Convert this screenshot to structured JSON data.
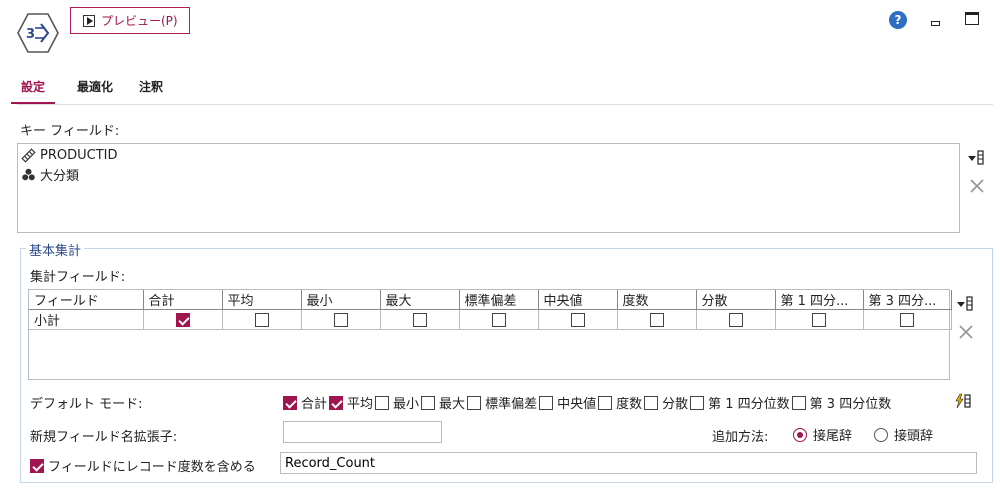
{
  "header": {
    "preview_label": "プレビュー(P)"
  },
  "tabs": [
    {
      "label": "設定",
      "active": true
    },
    {
      "label": "最適化",
      "active": false
    },
    {
      "label": "注釈",
      "active": false
    }
  ],
  "key_fields": {
    "label": "キー フィールド:",
    "items": [
      {
        "name": "PRODUCTID",
        "icon": "nominal-field-icon"
      },
      {
        "name": "大分類",
        "icon": "set-field-icon"
      }
    ]
  },
  "basic_agg": {
    "legend": "基本集計",
    "agg_fields_label": "集計フィールド:",
    "columns": [
      "フィールド",
      "合計",
      "平均",
      "最小",
      "最大",
      "標準偏差",
      "中央値",
      "度数",
      "分散",
      "第 1 四分...",
      "第 3 四分..."
    ],
    "rows": [
      {
        "field": "小計",
        "checks": [
          true,
          false,
          false,
          false,
          false,
          false,
          false,
          false,
          false,
          false
        ]
      }
    ],
    "default_mode_label": "デフォルト モード:",
    "default_modes": [
      {
        "label": "合計",
        "checked": true
      },
      {
        "label": "平均",
        "checked": true
      },
      {
        "label": "最小",
        "checked": false
      },
      {
        "label": "最大",
        "checked": false
      },
      {
        "label": "標準偏差",
        "checked": false
      },
      {
        "label": "中央値",
        "checked": false
      },
      {
        "label": "度数",
        "checked": false
      },
      {
        "label": "分散",
        "checked": false
      },
      {
        "label": "第 1 四分位数",
        "checked": false
      },
      {
        "label": "第 3 四分位数",
        "checked": false
      }
    ],
    "new_field_ext_label": "新規フィールド名拡張子:",
    "new_field_ext_value": "",
    "append_method_label": "追加方法:",
    "suffix_label": "接尾辞",
    "prefix_label": "接頭辞",
    "suffix_selected": true,
    "include_count_label": "フィールドにレコード度数を含める",
    "include_count_checked": true,
    "record_count_value": "Record_Count"
  },
  "colors": {
    "accent": "#a0144f",
    "help": "#2d6fc0",
    "group_border": "#c5d6e8"
  }
}
